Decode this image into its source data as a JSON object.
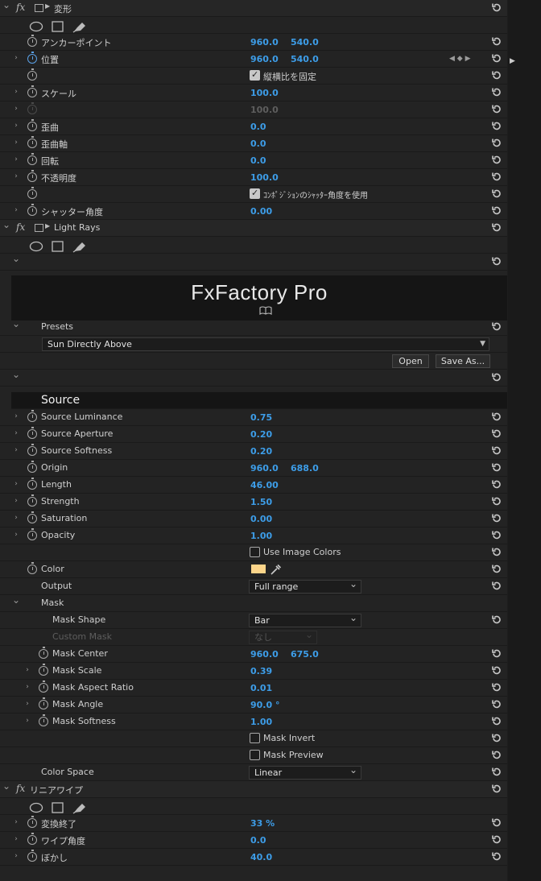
{
  "effects": {
    "transform": {
      "title": "変形",
      "rows": [
        {
          "label": "アンカーポイント",
          "v1": "960.0",
          "v2": "540.0"
        },
        {
          "label": "位置",
          "v1": "960.0",
          "v2": "540.0"
        },
        {
          "label": "",
          "checkbox": "縦横比を固定"
        },
        {
          "label": "スケール",
          "v1": "100.0"
        },
        {
          "label": "",
          "v1": "100.0"
        },
        {
          "label": "歪曲",
          "v1": "0.0"
        },
        {
          "label": "歪曲軸",
          "v1": "0.0"
        },
        {
          "label": "回転",
          "v1": "0.0"
        },
        {
          "label": "不透明度",
          "v1": "100.0"
        },
        {
          "label": "",
          "checkbox": "ｺﾝﾎﾟｼﾞｼｮﾝのｼｬｯﾀｰ角度を使用"
        },
        {
          "label": "シャッター角度",
          "v1": "0.00"
        }
      ]
    },
    "light_rays": {
      "title": "Light Rays",
      "banner": "FxFactory Pro",
      "presets": {
        "label": "Presets",
        "selected": "Sun Directly Above",
        "open_button": "Open",
        "save_button": "Save As..."
      },
      "source_heading": "Source",
      "rows": [
        {
          "label": "Source Luminance",
          "v1": "0.75"
        },
        {
          "label": "Source Aperture",
          "v1": "0.20"
        },
        {
          "label": "Source Softness",
          "v1": "0.20"
        },
        {
          "label": "Origin",
          "v1": "960.0",
          "v2": "688.0"
        },
        {
          "label": "Length",
          "v1": "46.00"
        },
        {
          "label": "Strength",
          "v1": "1.50"
        },
        {
          "label": "Saturation",
          "v1": "0.00"
        },
        {
          "label": "Opacity",
          "v1": "1.00"
        },
        {
          "label": "",
          "checkbox": "Use Image Colors"
        },
        {
          "label": "Color",
          "color": "#fcd58a"
        },
        {
          "label": "Output",
          "dropdown": "Full range"
        },
        {
          "label": "Mask"
        },
        {
          "label": "Mask Shape",
          "dropdown": "Bar"
        },
        {
          "label": "Custom Mask",
          "dropdown": "なし"
        },
        {
          "label": "Mask Center",
          "v1": "960.0",
          "v2": "675.0"
        },
        {
          "label": "Mask Scale",
          "v1": "0.39"
        },
        {
          "label": "Mask Aspect Ratio",
          "v1": "0.01"
        },
        {
          "label": "Mask Angle",
          "v1": "90.0 °"
        },
        {
          "label": "Mask Softness",
          "v1": "1.00"
        },
        {
          "label": "",
          "checkbox": "Mask Invert"
        },
        {
          "label": "",
          "checkbox": "Mask Preview"
        },
        {
          "label": "Color Space",
          "dropdown": "Linear"
        }
      ]
    },
    "linear_wipe": {
      "title": "リニアワイプ",
      "rows": [
        {
          "label": "変換終了",
          "v1": "33 %"
        },
        {
          "label": "ワイプ角度",
          "v1": "0.0"
        },
        {
          "label": "ぼかし",
          "v1": "40.0"
        }
      ]
    }
  },
  "icons": [
    "fx-icon",
    "transform-icon",
    "ellipse-mask-icon",
    "rectangle-mask-icon",
    "pen-mask-icon",
    "stopwatch-icon",
    "reset-icon",
    "chevron-icon",
    "keyframe-nav-icon",
    "book-icon",
    "eyedropper-icon",
    "dropdown-caret-icon"
  ],
  "colors": {
    "value_blue": "#3d9de8",
    "color_swatch": "#fcd58a",
    "panel_bg": "#232323"
  }
}
